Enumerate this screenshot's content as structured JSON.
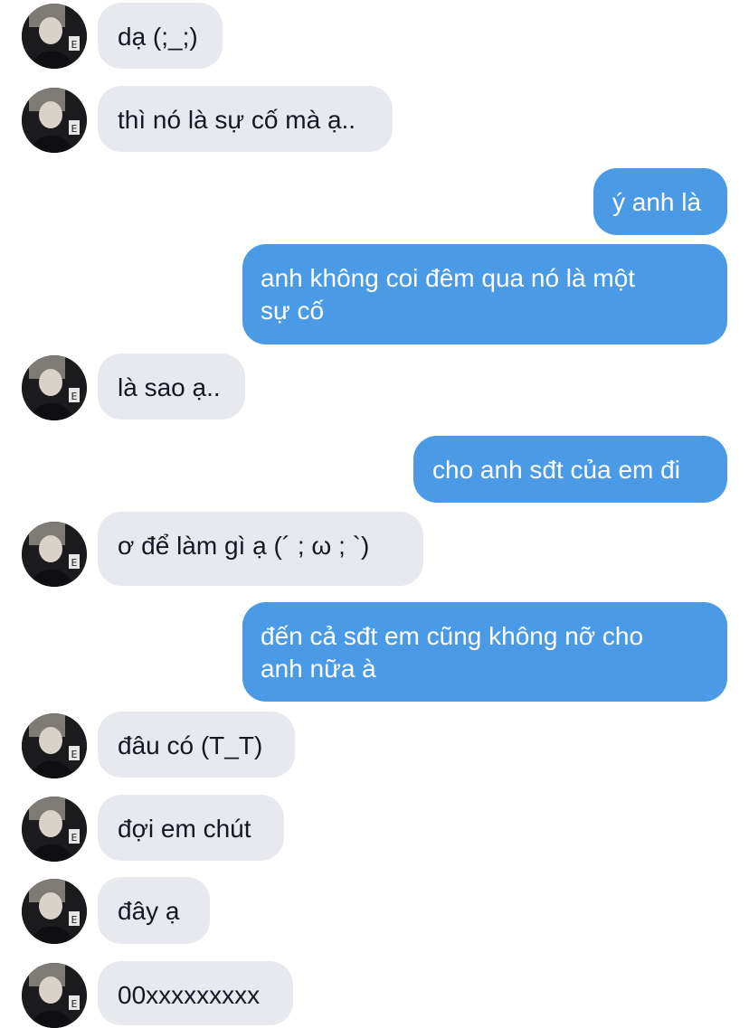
{
  "messages": [
    {
      "side": "in",
      "text": "dạ (;_;)"
    },
    {
      "side": "in",
      "text": "thì nó là sự cố mà ạ.."
    },
    {
      "side": "out",
      "text": "ý anh là"
    },
    {
      "side": "out",
      "text": "anh không coi đêm qua nó là một sự cố",
      "lines": [
        "anh không coi đêm qua nó là một",
        "sự cố"
      ]
    },
    {
      "side": "in",
      "text": "là sao ạ.."
    },
    {
      "side": "out",
      "text": "cho anh sđt của em đi"
    },
    {
      "side": "in",
      "text": "ơ để làm gì ạ (´ ; ω ; `)"
    },
    {
      "side": "out",
      "text": "đến cả sđt em cũng không nỡ cho anh nữa à",
      "lines": [
        "đến cả sđt em cũng không nỡ cho",
        "anh nữa à"
      ]
    },
    {
      "side": "in",
      "text": "đâu có (T_T)"
    },
    {
      "side": "in",
      "text": "đợi em chút"
    },
    {
      "side": "in",
      "text": "đây ạ"
    },
    {
      "side": "in",
      "text": "00xxxxxxxxx"
    }
  ],
  "colors": {
    "incoming_bubble": "#e8e9ee",
    "outgoing_bubble": "#4a9ae6",
    "incoming_text": "#141823",
    "outgoing_text": "#ffffff"
  },
  "icons": {
    "avatar": "contact-avatar-icon"
  }
}
